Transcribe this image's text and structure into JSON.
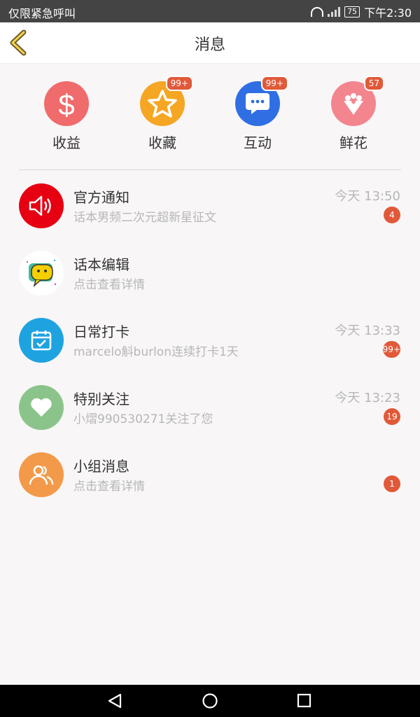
{
  "status_bar": {
    "left_text": "仅限紧急呼叫",
    "battery": "75",
    "time": "下午2:30"
  },
  "header": {
    "title": "消息",
    "icons": {
      "back": "chevron-left-icon"
    }
  },
  "categories": [
    {
      "label": "收益",
      "icon": "dollar-icon",
      "color": "#f06b6b",
      "badge": ""
    },
    {
      "label": "收藏",
      "icon": "star-icon",
      "color": "#f5a623",
      "badge": "99+"
    },
    {
      "label": "互动",
      "icon": "chat-bubble-icon",
      "color": "#2f6fe3",
      "badge": "99+"
    },
    {
      "label": "鲜花",
      "icon": "bouquet-icon",
      "color": "#f3858e",
      "badge": "57"
    }
  ],
  "messages": [
    {
      "name": "官方通知",
      "sub": "话本男频二次元超新星征文",
      "time": "今天 13:50",
      "count": "4",
      "icon": "speaker-icon",
      "color": "#e60012"
    },
    {
      "name": "话本编辑",
      "sub": "点击查看详情",
      "time": "",
      "count": "",
      "icon": "editor-avatar-icon",
      "color": "#ffffff"
    },
    {
      "name": "日常打卡",
      "sub": "marcelo斛burlon连续打卡1天",
      "time": "今天 13:33",
      "count": "99+",
      "icon": "calendar-check-icon",
      "color": "#1fa3e0"
    },
    {
      "name": "特别关注",
      "sub": "小熠990530271关注了您",
      "time": "今天 13:23",
      "count": "19",
      "icon": "heart-icon",
      "color": "#8bc48a"
    },
    {
      "name": "小组消息",
      "sub": "点击查看详情",
      "time": "",
      "count": "1",
      "icon": "group-icon",
      "color": "#f39a4a"
    }
  ],
  "nav_bar": {
    "icons": [
      "back-triangle-icon",
      "home-circle-icon",
      "recents-square-icon"
    ]
  }
}
